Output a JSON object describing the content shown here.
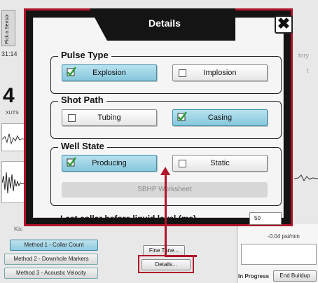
{
  "background": {
    "sensor_button": "Pick a Sensor",
    "time_text": "31:14",
    "big_value": "4",
    "small_label": "ХUTS",
    "tab_right": "tory",
    "side_t": "t",
    "kick_label": "Kic",
    "method_buttons": [
      "Method 1 - Collar Count",
      "Method 2 - Downhole Markers",
      "Method 3 - Acoustic Velocity"
    ],
    "fine_tune": "Fine Tune...",
    "details_button": "Details...",
    "rate_text": "-0.04 psi/min",
    "status_text": "In Progress",
    "end_buildup": "End Buildup"
  },
  "dialog": {
    "title": "Details",
    "close_symbol": "✖",
    "pulse_type": {
      "legend": "Pulse Type",
      "options": [
        {
          "label": "Explosion",
          "selected": true
        },
        {
          "label": "Implosion",
          "selected": false
        }
      ]
    },
    "shot_path": {
      "legend": "Shot Path",
      "options": [
        {
          "label": "Tubing",
          "selected": false
        },
        {
          "label": "Casing",
          "selected": true
        }
      ]
    },
    "well_state": {
      "legend": "Well State",
      "options": [
        {
          "label": "Producing",
          "selected": true
        },
        {
          "label": "Static",
          "selected": false
        }
      ]
    },
    "sbhp_button": "SBHP Worksheet",
    "last_collar_label": "Last collar before liquid level (ms)",
    "last_collar_value": "50"
  },
  "colors": {
    "frame_red": "#b0132a",
    "selected_blue": "#86c7dc",
    "check_green": "#2e9e3a"
  }
}
